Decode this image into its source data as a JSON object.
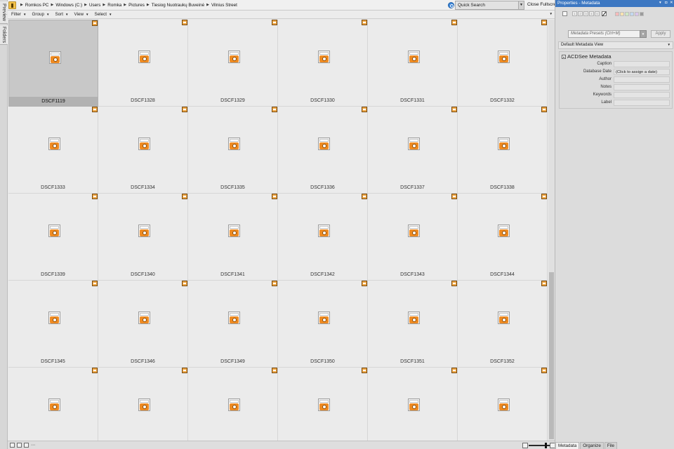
{
  "side_tabs": [
    "Preview",
    "Folders"
  ],
  "breadcrumb": [
    "Romkos PC",
    "Windows (C:)",
    "Users",
    "Romka",
    "Pictures",
    "Tiesiog Nuotraukų Buveinė",
    "Vilnius Street"
  ],
  "search": {
    "value": "Quick Search"
  },
  "close_fullscreen": "Close Fullscreen",
  "toolbar": {
    "filter": "Filter",
    "group": "Group",
    "sort": "Sort",
    "view": "View",
    "select": "Select"
  },
  "files": [
    "DSCF1119",
    "DSCF1328",
    "DSCF1329",
    "DSCF1330",
    "DSCF1331",
    "DSCF1332",
    "DSCF1333",
    "DSCF1334",
    "DSCF1335",
    "DSCF1336",
    "DSCF1337",
    "DSCF1338",
    "DSCF1339",
    "DSCF1340",
    "DSCF1341",
    "DSCF1342",
    "DSCF1343",
    "DSCF1344",
    "DSCF1345",
    "DSCF1346",
    "DSCF1349",
    "DSCF1350",
    "DSCF1351",
    "DSCF1352",
    "",
    "",
    "",
    "",
    "",
    ""
  ],
  "selected_file": "DSCF1119",
  "icons": {
    "file": "raw-file-icon",
    "badge": "raw-badge-icon",
    "folder": "folder-icon",
    "refresh": "refresh-icon"
  },
  "props": {
    "title": "Properties - Metadata",
    "rating_numbers": [
      "1",
      "2",
      "3",
      "4",
      "5"
    ],
    "label_colors": [
      "#f5b9b9",
      "#f8e2b0",
      "#cfe8c3",
      "#c2d8ef",
      "#d9c6ec",
      "#9b9b9b"
    ],
    "presets_placeholder": "Metadata Presets (Ctrl+M)",
    "apply": "Apply",
    "view": "Default Metadata View",
    "section": "ACDSee Metadata",
    "fields": [
      {
        "label": "Caption",
        "value": ""
      },
      {
        "label": "Database Date",
        "value": "(Click to assign a date)"
      },
      {
        "label": "Author",
        "value": ""
      },
      {
        "label": "Notes",
        "value": ""
      },
      {
        "label": "Keywords",
        "value": ""
      },
      {
        "label": "Label",
        "value": ""
      }
    ],
    "tabs": [
      "Metadata",
      "Organize",
      "File"
    ],
    "active_tab": "Metadata"
  }
}
